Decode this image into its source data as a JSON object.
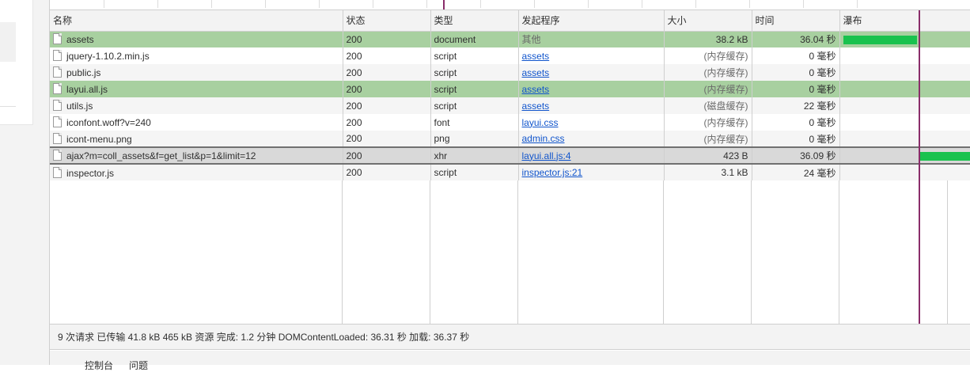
{
  "columns": [
    "名称",
    "状态",
    "类型",
    "发起程序",
    "大小",
    "时间",
    "瀑布"
  ],
  "rows": [
    {
      "name": "assets",
      "status": "200",
      "type": "document",
      "initiator": "其他",
      "initiator_link": false,
      "size": "38.2 kB",
      "size_cached": false,
      "time": "36.04 秒",
      "style": "r-sel",
      "waterfall": {
        "bar_start": 0.0,
        "bar_end": 0.58,
        "tick": false
      }
    },
    {
      "name": "jquery-1.10.2.min.js",
      "status": "200",
      "type": "script",
      "initiator": "assets",
      "initiator_link": true,
      "size": "(内存缓存)",
      "size_cached": true,
      "time": "0 毫秒",
      "style": "r-odd",
      "waterfall": {
        "tick": true
      }
    },
    {
      "name": "public.js",
      "status": "200",
      "type": "script",
      "initiator": "assets",
      "initiator_link": true,
      "size": "(内存缓存)",
      "size_cached": true,
      "time": "0 毫秒",
      "style": "r-even",
      "waterfall": {
        "tick": true
      }
    },
    {
      "name": "layui.all.js",
      "status": "200",
      "type": "script",
      "initiator": "assets",
      "initiator_link": true,
      "size": "(内存缓存)",
      "size_cached": true,
      "time": "0 毫秒",
      "style": "r-sel",
      "waterfall": {
        "tick": true
      }
    },
    {
      "name": "utils.js",
      "status": "200",
      "type": "script",
      "initiator": "assets",
      "initiator_link": true,
      "size": "(磁盘缓存)",
      "size_cached": true,
      "time": "22 毫秒",
      "style": "r-even",
      "waterfall": {
        "tick": true
      }
    },
    {
      "name": "iconfont.woff?v=240",
      "status": "200",
      "type": "font",
      "initiator": "layui.css",
      "initiator_link": true,
      "size": "(内存缓存)",
      "size_cached": true,
      "time": "0 毫秒",
      "style": "r-odd",
      "waterfall": {
        "tick": true
      }
    },
    {
      "name": "icont-menu.png",
      "status": "200",
      "type": "png",
      "initiator": "admin.css",
      "initiator_link": true,
      "size": "(内存缓存)",
      "size_cached": true,
      "time": "0 毫秒",
      "style": "r-even",
      "waterfall": {
        "tick": true
      }
    },
    {
      "name": "ajax?m=coll_assets&f=get_list&p=1&limit=12",
      "status": "200",
      "type": "xhr",
      "initiator": "layui.all.js:4",
      "initiator_link": true,
      "size": "423 B",
      "size_cached": false,
      "time": "36.09 秒",
      "style": "r-focus",
      "waterfall": {
        "bar_start": 0.6,
        "bar_end": 1.0,
        "tick": false
      }
    },
    {
      "name": "inspector.js",
      "status": "200",
      "type": "script",
      "initiator": "inspector.js:21",
      "initiator_link": true,
      "size": "3.1 kB",
      "size_cached": false,
      "time": "24 毫秒",
      "style": "r-even",
      "waterfall": {
        "tick": false
      }
    }
  ],
  "status_bar": {
    "text": "9 次请求  已传输 41.8 kB  465 kB 资源  完成: 1.2 分钟  DOMContentLoaded: 36.31 秒  加载: 36.37 秒"
  },
  "drawer_tabs": [
    "控制台",
    "问题"
  ]
}
